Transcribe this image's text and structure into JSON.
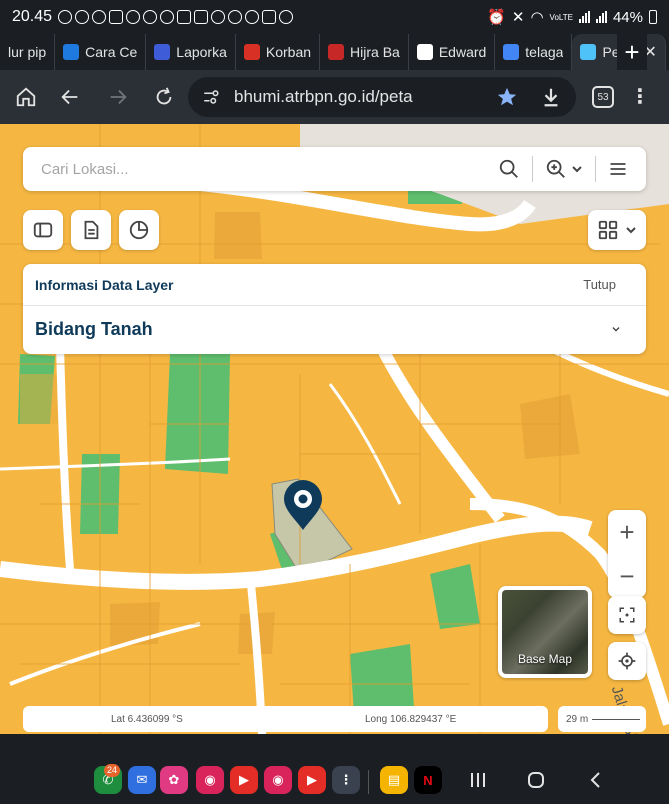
{
  "status_bar": {
    "time": "20.45",
    "battery": "44%",
    "network": "VoLTE"
  },
  "tabs": [
    {
      "label": "lur pip",
      "favicon_color": "#1b1f24"
    },
    {
      "label": "Cara Ce",
      "favicon_color": "#1f7ae0"
    },
    {
      "label": "Laporka",
      "favicon_color": "#3e5bd8"
    },
    {
      "label": "Korban",
      "favicon_color": "#d93025"
    },
    {
      "label": "Hijra Ba",
      "favicon_color": "#c62828"
    },
    {
      "label": "Edward",
      "favicon_color": "#ffffff"
    },
    {
      "label": "telaga",
      "favicon_color": "#4285f4"
    },
    {
      "label": "Pet",
      "favicon_color": "#4fc3f7",
      "active": true
    }
  ],
  "toolbar": {
    "url": "bhumi.atrbpn.go.id/peta",
    "tab_count": "53"
  },
  "map": {
    "search_placeholder": "Cari Lokasi...",
    "info_panel": {
      "title": "Informasi Data Layer",
      "close_label": "Tutup",
      "layer_name": "Bidang Tanah"
    },
    "basemap_label": "Base Map",
    "coordinates": {
      "lat": "Lat 6.436099 °S",
      "long": "Long 106.829437 °E"
    },
    "scale": "29 m",
    "road_label": "Jalan Sh",
    "colors": {
      "parcel": "#f6b742",
      "green": "#5fbe6d",
      "road": "#ffffff",
      "marker": "#0f3a59"
    }
  },
  "navbar": {
    "apps": [
      {
        "name": "phone",
        "color": "#1e8e3e",
        "glyph": "✆"
      },
      {
        "name": "messages",
        "color": "#2f6fe0",
        "glyph": "✉"
      },
      {
        "name": "flower",
        "color": "#e03a83",
        "glyph": "✿"
      },
      {
        "name": "camera-red",
        "color": "#d8245b",
        "glyph": "◉"
      },
      {
        "name": "youtube-music",
        "color": "#e52d27",
        "glyph": "▶"
      },
      {
        "name": "instagram",
        "color": "#d8245b",
        "glyph": "◉"
      },
      {
        "name": "youtube",
        "color": "#e52d27",
        "glyph": "▶"
      },
      {
        "name": "app-grid",
        "color": "#3a4250",
        "glyph": "⋮"
      },
      {
        "name": "docs",
        "color": "#f4b400",
        "glyph": "▤"
      },
      {
        "name": "netflix",
        "color": "#000000",
        "glyph": "N"
      }
    ],
    "phone_badge": "24"
  }
}
